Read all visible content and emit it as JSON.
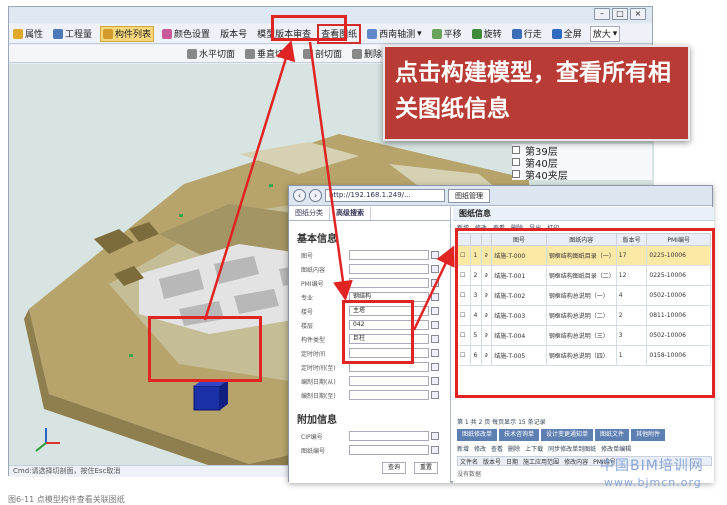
{
  "toolbar": {
    "items": [
      {
        "label": "属性",
        "active": false
      },
      {
        "label": "工程量",
        "active": false
      },
      {
        "label": "构件列表",
        "active": true
      },
      {
        "label": "颜色设置",
        "active": false
      },
      {
        "label": "版本号",
        "active": false
      },
      {
        "label": "模型版本审查",
        "active": false
      },
      {
        "label": "查看图纸",
        "active": false,
        "highlighted": true
      },
      {
        "label": "西南轴测",
        "active": false
      },
      {
        "label": "平移",
        "active": false
      },
      {
        "label": "旋转",
        "active": false
      },
      {
        "label": "行走",
        "active": false
      },
      {
        "label": "全屏",
        "active": false
      },
      {
        "label": "放大",
        "active": false
      }
    ],
    "row2": [
      {
        "label": "水平切面"
      },
      {
        "label": "垂直切面"
      },
      {
        "label": "剖切面"
      },
      {
        "label": "删除"
      }
    ]
  },
  "callout": "点击构建模型，查看所有相关图纸信息",
  "floors": [
    "第39层",
    "第40层",
    "第40夹层"
  ],
  "browser": {
    "address": "http://192.168.1.249/...",
    "tab": "图纸管理",
    "left_tabs": [
      "图纸分类",
      "高级搜索"
    ],
    "basic_title": "基本信息",
    "fields": [
      {
        "label": "图号",
        "value": ""
      },
      {
        "label": "图纸内容",
        "value": ""
      },
      {
        "label": "PMI编号",
        "value": ""
      },
      {
        "label": "专业",
        "value": "钢结构"
      },
      {
        "label": "楼号",
        "value": "主塔"
      },
      {
        "label": "楼层",
        "value": "042"
      },
      {
        "label": "构件类型",
        "value": "巨柱"
      },
      {
        "label": "定时时间",
        "value": ""
      },
      {
        "label": "定时时间(至)",
        "value": ""
      },
      {
        "label": "编制日期(从)",
        "value": ""
      },
      {
        "label": "编制日期(至)",
        "value": ""
      }
    ],
    "extra_title": "附加信息",
    "extra_fields": [
      {
        "label": "CIP编号",
        "value": ""
      },
      {
        "label": "图纸编号",
        "value": ""
      }
    ],
    "search_buttons": [
      "查询",
      "重置"
    ],
    "right_title": "图纸信息",
    "right_tools": [
      "新增",
      "修改",
      "查看",
      "删除",
      "导出",
      "打印"
    ],
    "columns": [
      "",
      "",
      "",
      "图号",
      "图纸内容",
      "版本号",
      "PMI编号"
    ],
    "rows": [
      {
        "no": "1",
        "drawing": "结施-T-000",
        "content": "钢框结构图纸目录（一）",
        "version": "17",
        "pmi": "0225-10006",
        "selected": true
      },
      {
        "no": "2",
        "drawing": "结施-T-001",
        "content": "钢框结构图纸目录（二）",
        "version": "12",
        "pmi": "0225-10006",
        "selected": false
      },
      {
        "no": "3",
        "drawing": "结施-T-002",
        "content": "钢框结构总说明（一）",
        "version": "4",
        "pmi": "0502-10006",
        "selected": false
      },
      {
        "no": "4",
        "drawing": "结施-T-003",
        "content": "钢框结构总说明（二）",
        "version": "2",
        "pmi": "0811-10006",
        "selected": false
      },
      {
        "no": "5",
        "drawing": "结施-T-004",
        "content": "钢框结构总说明（三）",
        "version": "3",
        "pmi": "0502-10006",
        "selected": false
      },
      {
        "no": "6",
        "drawing": "结施-T-005",
        "content": "钢框结构总说明（四）",
        "version": "1",
        "pmi": "0158-10006",
        "selected": false
      }
    ],
    "pager": "第 1 共 2 页  每页显示 15 条记录",
    "bottom_tabs": [
      "图纸修改单",
      "技术咨询单",
      "设计变更通知单",
      "图纸文件",
      "其他附件"
    ],
    "bottom_tools": [
      "新增",
      "修改",
      "查看",
      "删除",
      "上下载",
      "同步修改单到图纸",
      "修改单编辑"
    ],
    "bottom_columns": [
      "文件名",
      "版本号",
      "日期",
      "施工应用范围",
      "修改内容",
      "PMI编号"
    ],
    "bottom_empty": "没有数据"
  },
  "status": "Cmd:请选择切剖面，按住Esc取消",
  "watermark": {
    "line1": "中国BIM培训网",
    "line2": "www.bjmcn.org"
  },
  "caption": "图6-11 点模型构件查看关联图纸",
  "colors": {
    "callout": "#b83b35",
    "highlight": "#e02424",
    "selected_row": "#fce9a6",
    "tab_active": "#f6d77b"
  }
}
